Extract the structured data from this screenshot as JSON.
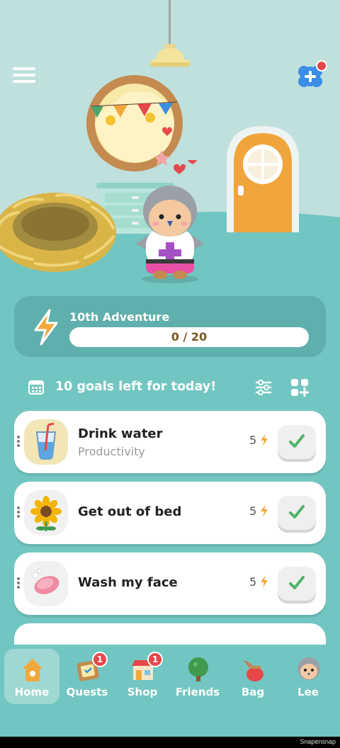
{
  "adventure": {
    "title": "10th Adventure",
    "progress_text": "0 / 20",
    "progress_fraction": 0.0
  },
  "goals_header": {
    "text": "10 goals left for today!"
  },
  "tasks": [
    {
      "title": "Drink water",
      "category": "Productivity",
      "points": "5",
      "thumb_bg": "#f2e6b7",
      "icon": "water-glass-icon"
    },
    {
      "title": "Get out of bed",
      "category": "",
      "points": "5",
      "thumb_bg": "#f1f1f1",
      "icon": "sunflower-icon"
    },
    {
      "title": "Wash my face",
      "category": "",
      "points": "5",
      "thumb_bg": "#f1f1f1",
      "icon": "soap-icon"
    }
  ],
  "nav": [
    {
      "label": "Home",
      "icon": "house-icon",
      "active": true
    },
    {
      "label": "Quests",
      "icon": "quest-board-icon",
      "badge": "1"
    },
    {
      "label": "Shop",
      "icon": "shop-icon",
      "badge": "1"
    },
    {
      "label": "Friends",
      "icon": "tree-icon"
    },
    {
      "label": "Bag",
      "icon": "bag-icon"
    },
    {
      "label": "Lee",
      "icon": "avatar-icon"
    }
  ],
  "watermark": "Snapensnap",
  "colors": {
    "teal": "#72c6c1",
    "accent": "#f2a93b",
    "check_green": "#4fb36a",
    "badge_red": "#e6484a"
  }
}
